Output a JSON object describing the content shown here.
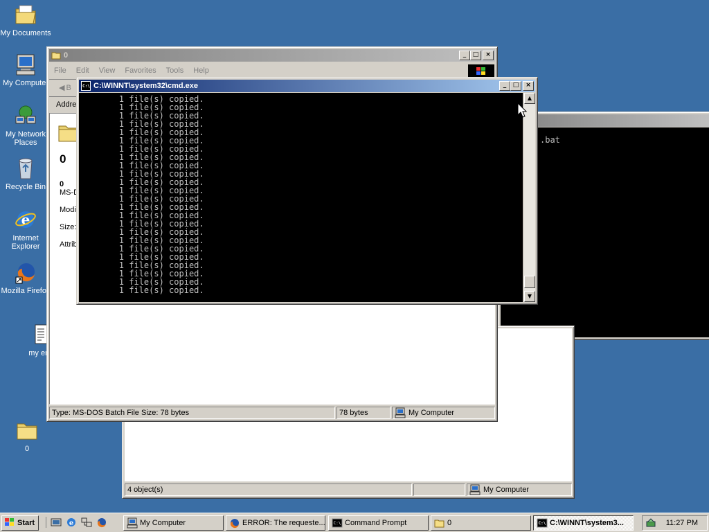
{
  "desktop": {
    "icons": [
      {
        "label": "My Documents",
        "icon": "my-documents-icon"
      },
      {
        "label": "My Computer",
        "icon": "my-computer-icon"
      },
      {
        "label": "My Network\nPlaces",
        "icon": "network-places-icon"
      },
      {
        "label": "Recycle Bin",
        "icon": "recycle-bin-icon"
      },
      {
        "label": "Internet\nExplorer",
        "icon": "internet-explorer-icon"
      },
      {
        "label": "Mozilla Firefox",
        "icon": "firefox-icon"
      },
      {
        "label": "my enti",
        "icon": "text-file-icon"
      },
      {
        "label": "0",
        "icon": "folder-icon"
      }
    ]
  },
  "back_window": {
    "title": "",
    "partial_text": ".bat"
  },
  "behind_explorer": {
    "status_left": "4 object(s)",
    "status_right": "My Computer"
  },
  "explorer": {
    "title": "0",
    "menu": [
      "File",
      "Edit",
      "View",
      "Favorites",
      "Tools",
      "Help"
    ],
    "back_label": "B",
    "address_label": "Addre",
    "folder_title": "0",
    "details": {
      "name": "0",
      "type": "MS-D",
      "modified_label": "Modif",
      "size_label": "Size:",
      "attributes_label": "Attrib"
    },
    "status": {
      "left": "Type: MS-DOS Batch File Size: 78 bytes",
      "middle": "78 bytes",
      "right": "My Computer"
    }
  },
  "cmd": {
    "title": "C:\\WINNT\\system32\\cmd.exe",
    "lines": [
      "        1 file(s) copied.",
      "        1 file(s) copied.",
      "        1 file(s) copied.",
      "        1 file(s) copied.",
      "        1 file(s) copied.",
      "        1 file(s) copied.",
      "        1 file(s) copied.",
      "        1 file(s) copied.",
      "        1 file(s) copied.",
      "        1 file(s) copied.",
      "        1 file(s) copied.",
      "        1 file(s) copied.",
      "        1 file(s) copied.",
      "        1 file(s) copied.",
      "        1 file(s) copied.",
      "        1 file(s) copied.",
      "        1 file(s) copied.",
      "        1 file(s) copied.",
      "        1 file(s) copied.",
      "        1 file(s) copied.",
      "        1 file(s) copied.",
      "        1 file(s) copied.",
      "        1 file(s) copied.",
      "        1 file(s) copied."
    ]
  },
  "taskbar": {
    "start_label": "Start",
    "tasks": [
      {
        "label": "My Computer",
        "icon": "my-computer-icon"
      },
      {
        "label": "ERROR: The requeste...",
        "icon": "firefox-icon"
      },
      {
        "label": "Command Prompt",
        "icon": "cmd-icon"
      },
      {
        "label": "0",
        "icon": "folder-icon"
      },
      {
        "label": "C:\\WINNT\\system3...",
        "icon": "cmd-icon",
        "active": true
      }
    ],
    "clock": "11:27 PM"
  },
  "colors": {
    "desktop": "#3a6ea5",
    "active_title_start": "#0a246a",
    "active_title_end": "#a6caf0",
    "console_text": "#c0c0c0"
  }
}
